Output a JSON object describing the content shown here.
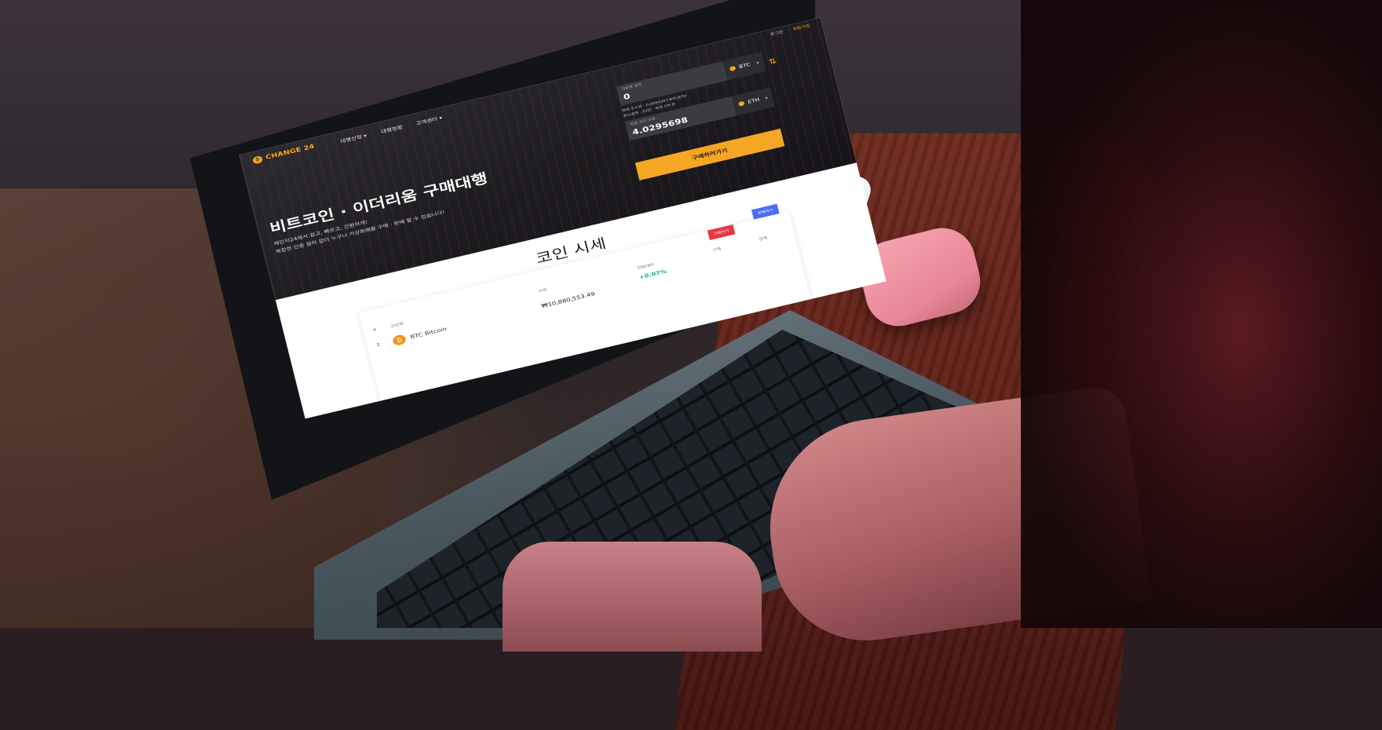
{
  "site": {
    "logo_text": "CHANGE 24",
    "nav": [
      "대행신청 ▾",
      "대행현황",
      "고객센터 ▾"
    ],
    "top_links": [
      "로그인",
      "회원가입"
    ]
  },
  "hero": {
    "title": "비트코인 · 이더리움 구매대행",
    "subtitle_line1": "체인지24에서 쉽고, 빠르고, 간편하게!",
    "subtitle_line2": "복잡한 인증 절차 없이 누구나 가상화폐를 구매 · 판매 할 수 있습니다!"
  },
  "exchange": {
    "from": {
      "label": "지불할 금액",
      "value": "0",
      "coin": "BTC"
    },
    "to": {
      "label": "받을 코인 수량",
      "value": "4.0295698",
      "coin": "ETH"
    },
    "info_line1": "현재 수수료 : 0.0094307 BTC/ETH",
    "info_line2": "최소금액 : 10만 · 최대 1억 원",
    "buy_button": "구매하러가기"
  },
  "prices": {
    "title": "코인 시세",
    "headers": {
      "rank": "#",
      "name": "코인명",
      "price": "가격",
      "change": "전일대비",
      "buy": "구매",
      "sell": "전체"
    },
    "sell_button": "구매하기",
    "all_button": "판매하기",
    "rows": [
      {
        "rank": "1",
        "name": "BTC Bitcoin",
        "price": "₩10,880,553.49",
        "change": "+0.07%"
      }
    ]
  },
  "colors": {
    "accent": "#f5a623",
    "buy": "#e63946",
    "sell": "#4c6ef5",
    "up": "#18b26b"
  }
}
